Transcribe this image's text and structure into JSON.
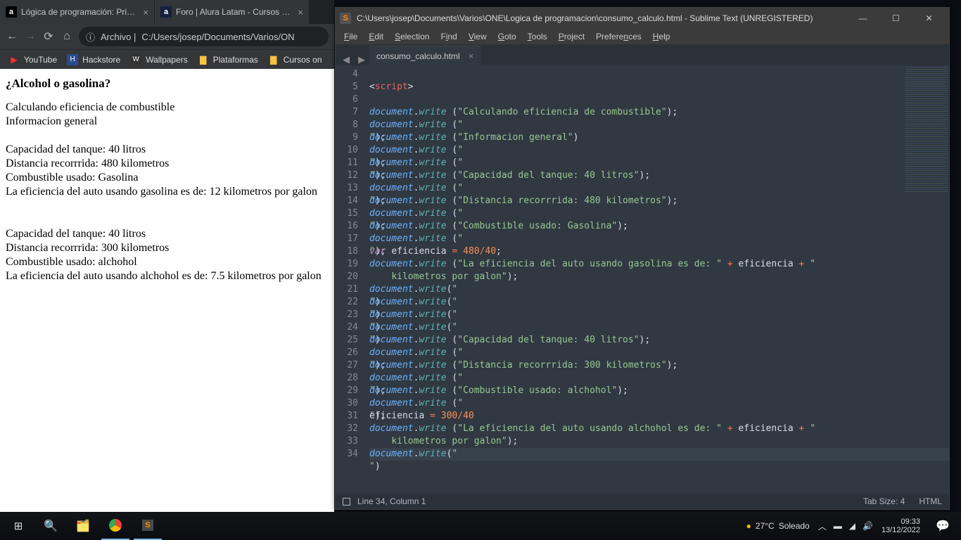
{
  "chrome": {
    "tabs": [
      {
        "favicon": "a",
        "favcolor": "#fff",
        "favbg": "#000",
        "title": "Lógica de programación: Primero"
      },
      {
        "favicon": "a",
        "favcolor": "#fff",
        "favbg": "#14213d",
        "title": "Foro | Alura Latam - Cursos onlin"
      }
    ],
    "omnibox_prefix": "Archivo |",
    "omnibox_path": "C:/Users/josep/Documents/Varios/ON",
    "bookmarks": [
      {
        "icon": "▶",
        "color": "#ff2d2d",
        "label": "YouTube"
      },
      {
        "icon": "H",
        "color": "#2a4b8d",
        "label": "Hackstore"
      },
      {
        "icon": "W",
        "color": "#333",
        "label": "Wallpapers"
      },
      {
        "icon": "📁",
        "color": "#f5c147",
        "label": "Plataformas"
      },
      {
        "icon": "📁",
        "color": "#f5c147",
        "label": "Cursos on"
      }
    ],
    "page": {
      "heading": "¿Alcohol o gasolina?",
      "l1": "Calculando eficiencia de combustible",
      "l2": "Informacion general",
      "l3": "Capacidad del tanque: 40 litros",
      "l4": "Distancia recorrrida: 480 kilometros",
      "l5": "Combustible usado: Gasolina",
      "l6": "La eficiencia del auto usando gasolina es de: 12 kilometros por galon",
      "l7": "Capacidad del tanque: 40 litros",
      "l8": "Distancia recorrrida: 300 kilometros",
      "l9": "Combustible usado: alchohol",
      "l10": "La eficiencia del auto usando alchohol es de: 7.5 kilometros por galon"
    }
  },
  "sublime": {
    "title": "C:\\Users\\josep\\Documents\\Varios\\ONE\\Logica de programacion\\consumo_calculo.html - Sublime Text (UNREGISTERED)",
    "menu": [
      "File",
      "Edit",
      "Selection",
      "Find",
      "View",
      "Goto",
      "Tools",
      "Project",
      "Preferences",
      "Help"
    ],
    "tab": "consumo_calculo.html",
    "status_left": "Line 34, Column 1",
    "status_tabsize": "Tab Size: 4",
    "status_lang": "HTML",
    "line_start": 4,
    "line_end": 34
  },
  "code": {
    "s4": "script",
    "s7": "\"Calculando eficiencia de combustible\"",
    "sbr": "\"<br>\"",
    "s9": "\"Informacion general\"",
    "s12": "\"Capacidad del tanque: 40 litros\"",
    "s14": "\"Distancia recorrrida: 480 kilometros\"",
    "s16": "\"Combustible usado: Gasolina\"",
    "s19a": "\"La eficiencia del auto usando gasolina es de: \"",
    "s19b": "\"\n         kilometros por galon\"",
    "s24": "\"Capacidad del tanque: 40 litros\"",
    "s26": "\"Distancia recorrrida: 300 kilometros\"",
    "s28": "\"Combustible usado: alchohol\"",
    "s31a": "\"La eficiencia del auto usando alchohol es de: \"",
    "s31b": "\" kilometros por galon\"",
    "n480": "480",
    "n40": "40",
    "n300": "300",
    "var": "var",
    "eff": "eficiencia",
    "doc": "document",
    "write": "write"
  },
  "taskbar": {
    "weather_temp": "27°C",
    "weather_text": "Soleado",
    "time": "09:33",
    "date": "13/12/2022"
  }
}
